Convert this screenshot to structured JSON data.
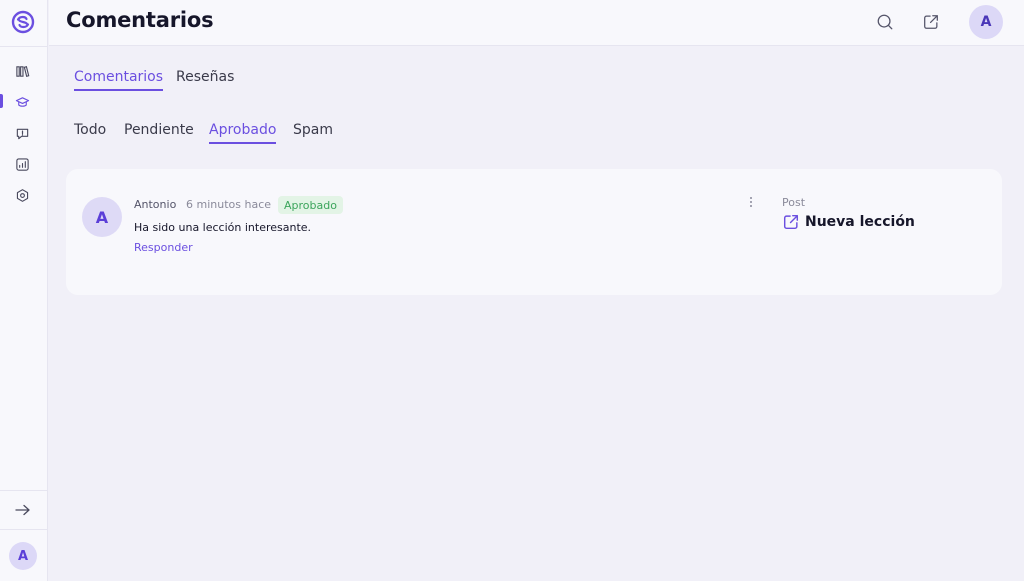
{
  "app": {
    "brand_color": "#6b4fe0"
  },
  "sidebar": {
    "items": [
      {
        "icon": "library-icon",
        "name": "sidebar-item-library"
      },
      {
        "icon": "graduation-cap-icon",
        "name": "sidebar-item-courses",
        "active": true
      },
      {
        "icon": "comment-alert-icon",
        "name": "sidebar-item-comments"
      },
      {
        "icon": "chart-icon",
        "name": "sidebar-item-analytics"
      },
      {
        "icon": "settings-icon",
        "name": "sidebar-item-settings"
      }
    ],
    "collapse_icon": "arrow-right-icon",
    "user_initial": "A"
  },
  "header": {
    "title": "Comentarios",
    "search_icon": "search-icon",
    "external_icon": "external-link-icon",
    "user_initial": "A"
  },
  "tabs": [
    {
      "label": "Comentarios",
      "active": true
    },
    {
      "label": "Reseñas",
      "active": false
    }
  ],
  "filters": [
    {
      "label": "Todo",
      "active": false
    },
    {
      "label": "Pendiente",
      "active": false
    },
    {
      "label": "Aprobado",
      "active": true
    },
    {
      "label": "Spam",
      "active": false
    }
  ],
  "comment": {
    "initial": "A",
    "author": "Antonio",
    "time": "6 minutos hace",
    "status": "Aprobado",
    "status_color": "#3ca55c",
    "text": "Ha sido una lección interesante.",
    "reply_label": "Responder",
    "post_label": "Post",
    "post_title": "Nueva lección"
  }
}
